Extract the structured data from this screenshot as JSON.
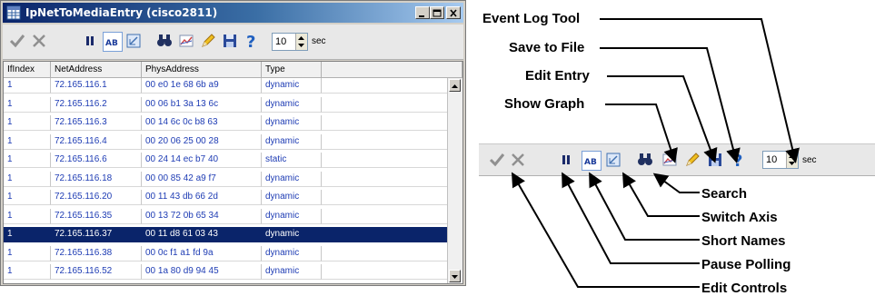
{
  "window": {
    "title": "IpNetToMediaEntry (cisco2811)",
    "controls": [
      "minimize",
      "maximize",
      "close"
    ]
  },
  "toolbar": {
    "icons": [
      "check-icon",
      "x-icon",
      "pause-icon",
      "ab-icon",
      "switch-axis-icon",
      "binoculars-icon",
      "graph-icon",
      "pencil-icon",
      "floppy-icon",
      "help-icon"
    ],
    "interval_value": "10",
    "interval_unit": "sec"
  },
  "table": {
    "columns": [
      "IfIndex",
      "NetAddress",
      "PhysAddress",
      "Type"
    ],
    "rows": [
      [
        "1",
        "72.165.116.1",
        "00 e0 1e 68 6b a9",
        "dynamic"
      ],
      [
        "1",
        "72.165.116.2",
        "00 06 b1 3a 13 6c",
        "dynamic"
      ],
      [
        "1",
        "72.165.116.3",
        "00 14 6c 0c b8 63",
        "dynamic"
      ],
      [
        "1",
        "72.165.116.4",
        "00 20 06 25 00 28",
        "dynamic"
      ],
      [
        "1",
        "72.165.116.6",
        "00 24 14 ec b7 40",
        "static"
      ],
      [
        "1",
        "72.165.116.18",
        "00 00 85 42 a9 f7",
        "dynamic"
      ],
      [
        "1",
        "72.165.116.20",
        "00 11 43 db 66 2d",
        "dynamic"
      ],
      [
        "1",
        "72.165.116.35",
        "00 13 72 0b 65 34",
        "dynamic"
      ],
      [
        "1",
        "72.165.116.37",
        "00 11 d8 61 03 43",
        "dynamic"
      ],
      [
        "1",
        "72.165.116.38",
        "00 0c f1 a1 fd 9a",
        "dynamic"
      ],
      [
        "1",
        "72.165.116.52",
        "00 1a 80 d9 94 45",
        "dynamic"
      ]
    ],
    "selected_row": 8
  },
  "callouts": {
    "top": [
      "Event Log Tool",
      "Save to File",
      "Edit Entry",
      "Show Graph"
    ],
    "bottom": [
      "Search",
      "Switch Axis",
      "Short Names",
      "Pause Polling",
      "Edit Controls"
    ]
  },
  "strip": {
    "interval_value": "10",
    "interval_unit": "sec"
  },
  "colors": {
    "title_bar": "#0a246a",
    "cell_text": "#1e3cb4",
    "selected_row": "#0a246a"
  }
}
